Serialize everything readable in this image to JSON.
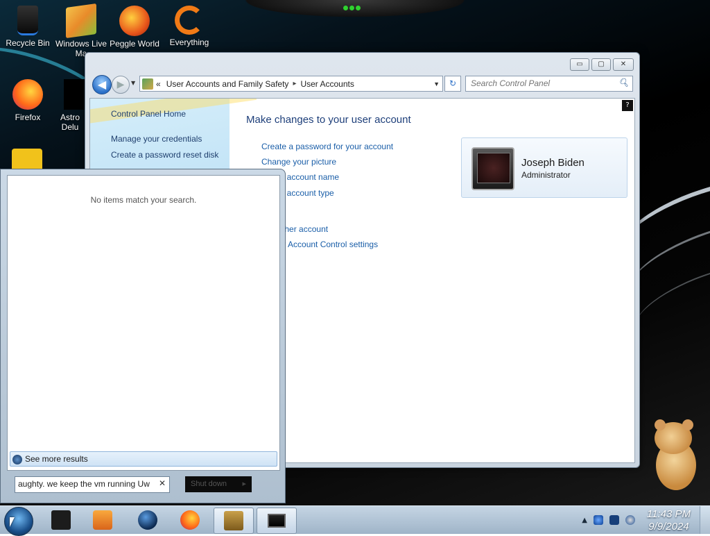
{
  "desktop": {
    "icons": [
      {
        "label": "Recycle Bin",
        "icon": "recycle-bin-icon"
      },
      {
        "label": "Windows Live Ma",
        "icon": "windows-live-mail-icon"
      },
      {
        "label": "Peggle World",
        "icon": "peggle-icon"
      },
      {
        "label": "Everything",
        "icon": "everything-icon"
      },
      {
        "label": "Firefox",
        "icon": "firefox-icon"
      },
      {
        "label": "Astro Delu",
        "icon": "astro-icon"
      }
    ]
  },
  "window": {
    "controls": {
      "minimize": "▭",
      "maximize": "▢",
      "close": "✕"
    },
    "nav": {
      "back": "◀",
      "forward": "▶",
      "dropdown": "▼",
      "refresh": "↻"
    },
    "address": {
      "prefix": "«",
      "crumbs": [
        "User Accounts and Family Safety",
        "User Accounts"
      ],
      "separator": "▸"
    },
    "search": {
      "placeholder": "Search Control Panel",
      "icon": "magnifier-icon"
    },
    "left_pane": {
      "links": [
        "Control Panel Home",
        "Manage your credentials",
        "Create a password reset disk"
      ]
    },
    "main": {
      "title": "Make changes to your user account",
      "tasks": [
        "Create a password for your account",
        "Change your picture",
        "e your account name",
        "e your account type",
        "e another account",
        "e User Account Control settings"
      ],
      "help": "?"
    },
    "user": {
      "name": "Joseph Biden",
      "role": "Administrator"
    }
  },
  "start_menu": {
    "no_items": "No items match your search.",
    "see_more": "See more results",
    "search_query": "aughty. we keep the vm running Uw",
    "clear": "✕",
    "shutdown_label": "Shut down",
    "shutdown_arrow": "▸"
  },
  "taskbar": {
    "items": [
      "black-app-icon",
      "media-player-icon",
      "globe-icon",
      "firefox-icon",
      "sandbox-icon",
      "monitor-icon"
    ],
    "tray": {
      "expand": "▲"
    },
    "clock": {
      "time": "11:43 PM",
      "date": "9/9/2024"
    }
  },
  "colors": {
    "link": "#1a5ea8",
    "title": "#1e3f7a",
    "clock": "#ffffff"
  }
}
